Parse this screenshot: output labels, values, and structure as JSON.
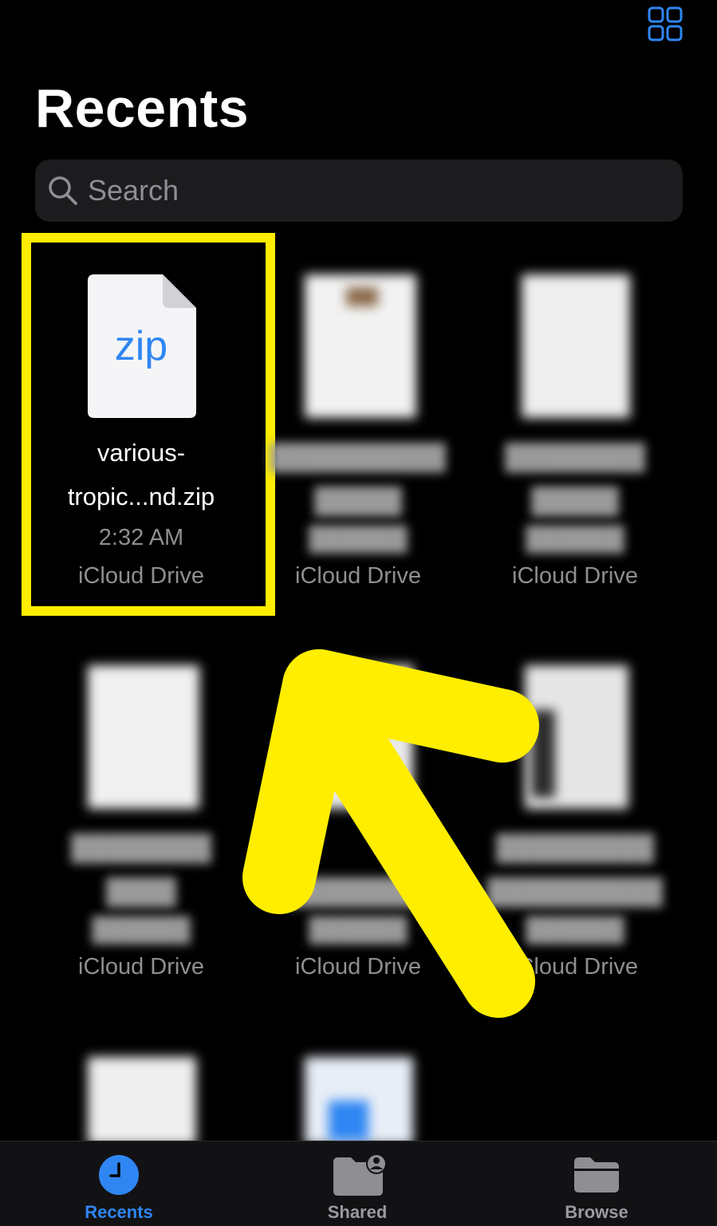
{
  "header": {
    "title": "Recents",
    "view_toggle_icon": "grid-icon"
  },
  "search": {
    "placeholder": "Search",
    "icon": "search-icon"
  },
  "files": [
    {
      "type_label": "zip",
      "name_line1": "various-",
      "name_line2": "tropic...nd.zip",
      "time": "2:32 AM",
      "location": "iCloud Drive",
      "highlighted": true
    },
    {
      "location": "iCloud Drive"
    },
    {
      "location": "iCloud Drive"
    },
    {
      "location": "iCloud Drive"
    },
    {
      "location": "iCloud Drive"
    },
    {
      "location": "iCloud Drive"
    }
  ],
  "tabbar": {
    "tabs": [
      {
        "label": "Recents",
        "icon": "clock-icon",
        "active": true
      },
      {
        "label": "Shared",
        "icon": "shared-folder-icon",
        "active": false
      },
      {
        "label": "Browse",
        "icon": "folder-icon",
        "active": false
      }
    ]
  },
  "colors": {
    "accent": "#2f86f2",
    "highlight": "#ffee00",
    "background": "#000000"
  }
}
